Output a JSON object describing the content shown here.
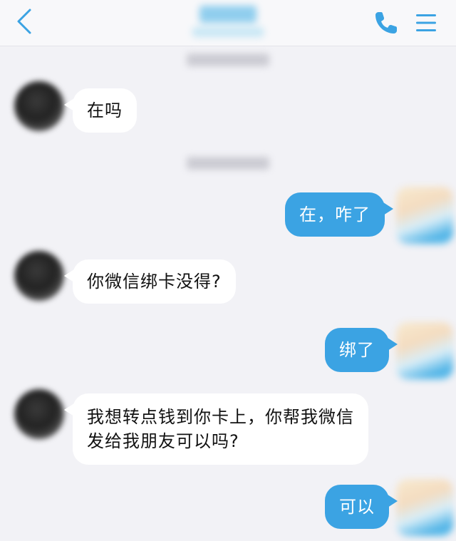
{
  "header": {
    "title": "",
    "subtitle": "",
    "back_icon": "chevron-left-icon",
    "call_icon": "phone-icon",
    "menu_icon": "menu-icon",
    "accent_color": "#3ba3e3"
  },
  "timestamps": [
    "",
    ""
  ],
  "messages": [
    {
      "sender": "contact",
      "text": "在吗"
    },
    {
      "sender": "me",
      "text": "在，咋了"
    },
    {
      "sender": "contact",
      "text": "你微信绑卡没得?"
    },
    {
      "sender": "me",
      "text": "绑了"
    },
    {
      "sender": "contact",
      "lines": [
        "我想转点钱到你卡上，你帮我微信",
        "发给我朋友可以吗?"
      ]
    },
    {
      "sender": "me",
      "text": "可以"
    }
  ]
}
